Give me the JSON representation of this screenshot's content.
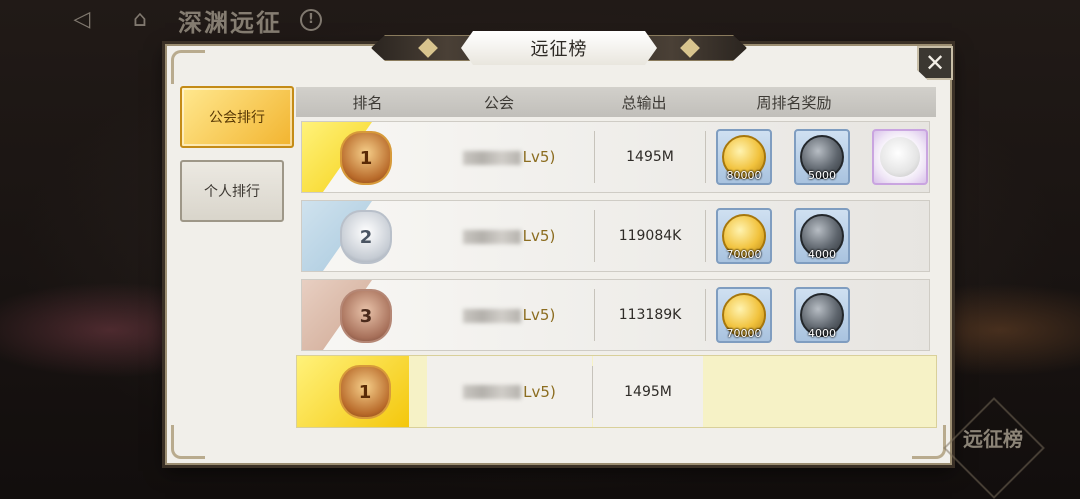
{
  "topbar": {
    "back_icon": "back-arrow-icon",
    "home_icon": "home-icon",
    "title": "深渊远征",
    "info_icon": "info-icon",
    "info_glyph": "!"
  },
  "panel": {
    "title": "远征榜",
    "close_label": "✕"
  },
  "tabs": [
    {
      "label": "公会排行",
      "active": true
    },
    {
      "label": "个人排行",
      "active": false
    }
  ],
  "table": {
    "headers": [
      "排名",
      "公会",
      "总输出",
      "周排名奖励"
    ],
    "rows": [
      {
        "rank": "1",
        "guild_level": "Lv5)",
        "damage": "1495M",
        "rewards": [
          {
            "type": "gold-coin",
            "qty": "80000"
          },
          {
            "type": "iron-coin",
            "qty": "5000"
          },
          {
            "type": "special-frame",
            "qty": ""
          }
        ]
      },
      {
        "rank": "2",
        "guild_level": "Lv5)",
        "damage": "119084K",
        "rewards": [
          {
            "type": "gold-coin",
            "qty": "70000"
          },
          {
            "type": "iron-coin",
            "qty": "4000"
          }
        ]
      },
      {
        "rank": "3",
        "guild_level": "Lv5)",
        "damage": "113189K",
        "rewards": [
          {
            "type": "gold-coin",
            "qty": "70000"
          },
          {
            "type": "iron-coin",
            "qty": "4000"
          }
        ]
      }
    ],
    "my_row": {
      "rank": "1",
      "guild_level": "Lv5)",
      "damage": "1495M"
    }
  },
  "side_button": {
    "label": "远征榜"
  },
  "colors": {
    "accent_gold": "#f2b42f",
    "panel_bg": "#f1efea",
    "level_text": "#8c6d20"
  }
}
